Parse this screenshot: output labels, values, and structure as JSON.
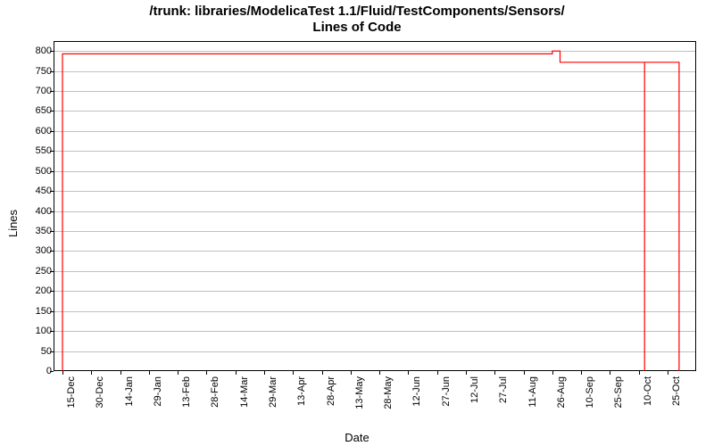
{
  "chart_data": {
    "type": "line",
    "title_line1": "/trunk: libraries/ModelicaTest 1.1/Fluid/TestComponents/Sensors/",
    "title_line2": "Lines of Code",
    "xlabel": "Date",
    "ylabel": "Lines",
    "ylim": [
      0,
      825
    ],
    "yticks": [
      0,
      50,
      100,
      150,
      200,
      250,
      300,
      350,
      400,
      450,
      500,
      550,
      600,
      650,
      700,
      750,
      800
    ],
    "xticks": [
      "15-Dec",
      "30-Dec",
      "14-Jan",
      "29-Jan",
      "13-Feb",
      "28-Feb",
      "14-Mar",
      "29-Mar",
      "13-Apr",
      "28-Apr",
      "13-May",
      "28-May",
      "12-Jun",
      "27-Jun",
      "12-Jul",
      "27-Jul",
      "11-Aug",
      "26-Aug",
      "10-Sep",
      "25-Sep",
      "10-Oct",
      "25-Oct"
    ],
    "series": [
      {
        "name": "Lines of Code",
        "color": "#ff0000",
        "points": [
          {
            "x": "15-Dec",
            "y": 0
          },
          {
            "x": "15-Dec",
            "y": 793
          },
          {
            "x": "26-Aug",
            "y": 793
          },
          {
            "x": "26-Aug",
            "y": 800
          },
          {
            "x": "30-Aug",
            "y": 800
          },
          {
            "x": "30-Aug",
            "y": 772
          },
          {
            "x": "13-Oct",
            "y": 772
          },
          {
            "x": "13-Oct",
            "y": 0
          },
          {
            "x": "13-Oct",
            "y": 772
          },
          {
            "x": "31-Oct",
            "y": 772
          },
          {
            "x": "31-Oct",
            "y": 0
          }
        ]
      }
    ]
  }
}
